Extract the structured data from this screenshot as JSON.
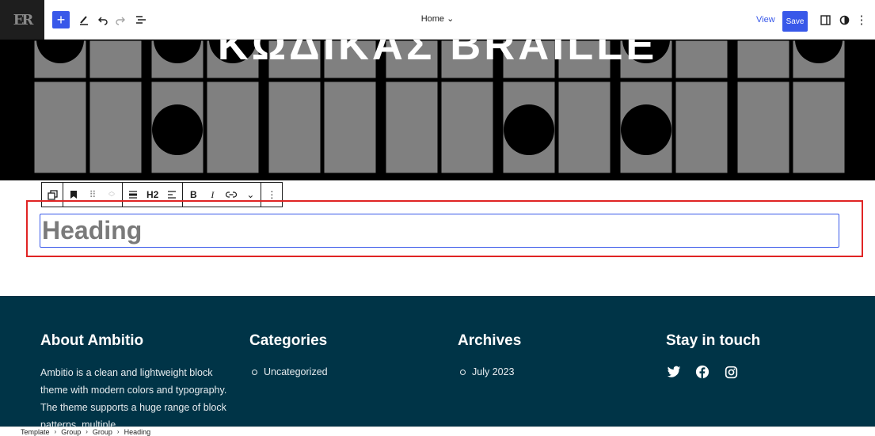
{
  "topbar": {
    "site_icon_text": "ER",
    "document_title": "Home",
    "view_label": "View",
    "save_label": "Save"
  },
  "hero": {
    "title_text": "ΚΩΔΙΚΑΣ BRAILLE"
  },
  "block_toolbar": {
    "heading_level": "H2",
    "bold_label": "B",
    "italic_label": "I"
  },
  "heading_block": {
    "placeholder": "Heading"
  },
  "footer": {
    "about": {
      "title": "About Ambitio",
      "text": "Ambitio is a clean and lightweight block theme with modern colors and typography. The theme supports a huge range of block patterns, multiple"
    },
    "categories": {
      "title": "Categories",
      "items": [
        "Uncategorized"
      ]
    },
    "archives": {
      "title": "Archives",
      "items": [
        "July 2023"
      ]
    },
    "contact": {
      "title": "Stay in touch"
    }
  },
  "breadcrumb": {
    "items": [
      "Template",
      "Group",
      "Group",
      "Heading"
    ]
  },
  "colors": {
    "accent": "#3858e9",
    "footer_bg": "#003447",
    "selection": "#e02424"
  },
  "icons": [
    "add-icon",
    "edit-tool-icon",
    "undo-icon",
    "redo-icon",
    "list-view-icon",
    "chevron-down-icon",
    "settings-panel-icon",
    "styles-icon",
    "more-options-icon",
    "twitter-icon",
    "facebook-icon",
    "instagram-icon"
  ]
}
